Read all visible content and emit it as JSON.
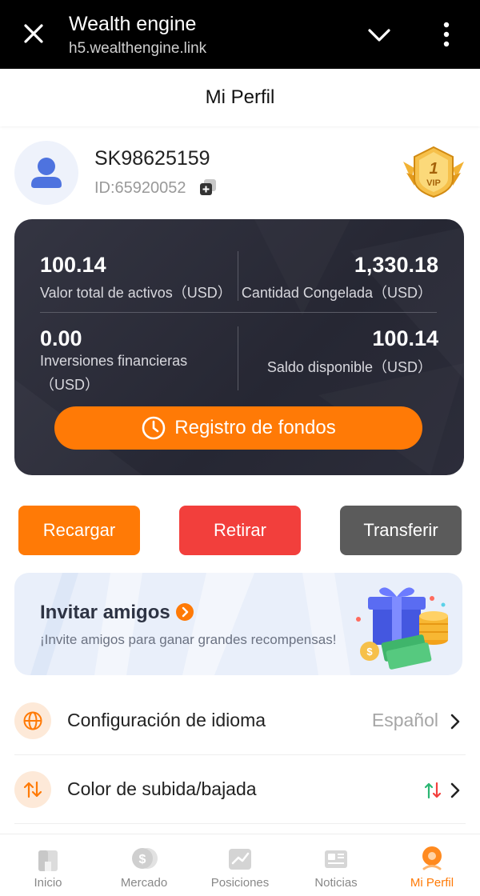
{
  "browser": {
    "title": "Wealth engine",
    "url": "h5.wealthengine.link"
  },
  "header": {
    "title": "Mi Perfil"
  },
  "profile": {
    "username": "SK98625159",
    "id_text": "ID:65920052",
    "vip_level": "1",
    "vip_text": "VIP"
  },
  "assets": {
    "total_value": "100.14",
    "total_label": "Valor total de activos（USD）",
    "frozen_value": "1,330.18",
    "frozen_label": "Cantidad Congelada（USD）",
    "investments_value": "0.00",
    "investments_label_1": "Inversiones financieras",
    "investments_label_2": "（USD）",
    "available_value": "100.14",
    "available_label": "Saldo disponible（USD）",
    "funds_button": "Registro de fondos"
  },
  "actions": {
    "recharge": "Recargar",
    "withdraw": "Retirar",
    "transfer": "Transferir"
  },
  "invite": {
    "title": "Invitar amigos",
    "subtitle": "¡Invite amigos para ganar grandes recompensas!"
  },
  "settings": [
    {
      "label": "Configuración de idioma",
      "value": "Español",
      "icon": "globe-icon"
    },
    {
      "label": "Color de subida/bajada",
      "value": "",
      "icon": "updown-arrows-icon"
    }
  ],
  "nav": [
    {
      "label": "Inicio",
      "icon": "home-icon"
    },
    {
      "label": "Mercado",
      "icon": "dollar-coin-icon"
    },
    {
      "label": "Posiciones",
      "icon": "chart-icon"
    },
    {
      "label": "Noticias",
      "icon": "news-icon"
    },
    {
      "label": "Mi Perfil",
      "icon": "profile-icon",
      "active": true
    }
  ],
  "colors": {
    "accent": "#ff7a06",
    "withdraw": "#f23f3c",
    "transfer": "#5b5b5b",
    "card_bg": "#2b2c38",
    "up": "#2bb673",
    "down": "#f23f3c"
  }
}
